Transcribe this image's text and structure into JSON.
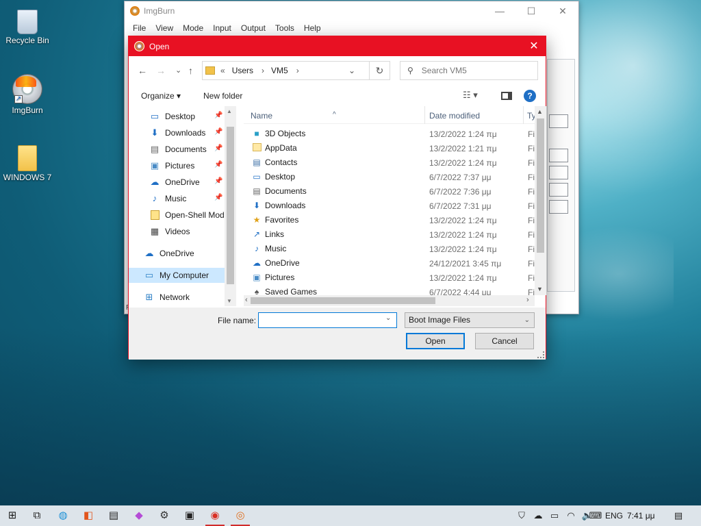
{
  "desktop": {
    "icons": [
      {
        "label": "Recycle Bin"
      },
      {
        "label": "ImgBurn"
      },
      {
        "label": "WINDOWS 7"
      }
    ]
  },
  "imgburn_window": {
    "title": "ImgBurn",
    "menu": [
      "File",
      "View",
      "Mode",
      "Input",
      "Output",
      "Tools",
      "Help"
    ],
    "status_text": "R"
  },
  "dialog": {
    "title": "Open",
    "close_glyph": "✕",
    "nav": {
      "back": "←",
      "forward": "→",
      "recent": "⌄",
      "up": "↑"
    },
    "address": {
      "prefix": "«",
      "segments": [
        "Users",
        "VM5"
      ],
      "separator": "›"
    },
    "refresh_glyph": "↻",
    "search": {
      "placeholder": "Search VM5"
    },
    "toolbar": {
      "organize": "Organize ▾",
      "new_folder": "New folder",
      "help": "?"
    },
    "nav_pane": {
      "items": [
        {
          "label": "Desktop",
          "icon": "desktop-icon",
          "pinned": true
        },
        {
          "label": "Downloads",
          "icon": "download-icon",
          "pinned": true
        },
        {
          "label": "Documents",
          "icon": "document-icon",
          "pinned": true
        },
        {
          "label": "Pictures",
          "icon": "picture-icon",
          "pinned": true
        },
        {
          "label": "OneDrive",
          "icon": "cloud-icon",
          "pinned": true
        },
        {
          "label": "Music",
          "icon": "music-icon",
          "pinned": true
        },
        {
          "label": "Open-Shell Mod",
          "icon": "folder-icon",
          "pinned": false
        },
        {
          "label": "Videos",
          "icon": "video-icon",
          "pinned": false
        }
      ],
      "onedrive": "OneDrive",
      "my_computer": "My Computer",
      "network": "Network"
    },
    "columns": {
      "name": "Name",
      "date": "Date modified",
      "type": "Ty"
    },
    "files": [
      {
        "name": "3D Objects",
        "date": "13/2/2022 1:24 πμ",
        "type": "Fi"
      },
      {
        "name": "AppData",
        "date": "13/2/2022 1:21 πμ",
        "type": "Fi"
      },
      {
        "name": "Contacts",
        "date": "13/2/2022 1:24 πμ",
        "type": "Fi"
      },
      {
        "name": "Desktop",
        "date": "6/7/2022 7:37 μμ",
        "type": "Fi"
      },
      {
        "name": "Documents",
        "date": "6/7/2022 7:36 μμ",
        "type": "Fi"
      },
      {
        "name": "Downloads",
        "date": "6/7/2022 7:31 μμ",
        "type": "Fi"
      },
      {
        "name": "Favorites",
        "date": "13/2/2022 1:24 πμ",
        "type": "Fi"
      },
      {
        "name": "Links",
        "date": "13/2/2022 1:24 πμ",
        "type": "Fi"
      },
      {
        "name": "Music",
        "date": "13/2/2022 1:24 πμ",
        "type": "Fi"
      },
      {
        "name": "OneDrive",
        "date": "24/12/2021 3:45 πμ",
        "type": "Fi"
      },
      {
        "name": "Pictures",
        "date": "13/2/2022 1:24 πμ",
        "type": "Fi"
      },
      {
        "name": "Saved Games",
        "date": "6/7/2022 4:44 μμ",
        "type": "Fi"
      }
    ],
    "file_name_label": "File name:",
    "file_name_value": "",
    "file_type": "Boot Image Files",
    "open_button": "Open",
    "cancel_button": "Cancel"
  },
  "taskbar": {
    "lang": "ENG",
    "time": "7:41 μμ"
  },
  "colors": {
    "dialog_accent": "#e81123",
    "focus": "#0078d7",
    "selection": "#cce8ff",
    "taskbar_bg": "#dde4ea"
  }
}
